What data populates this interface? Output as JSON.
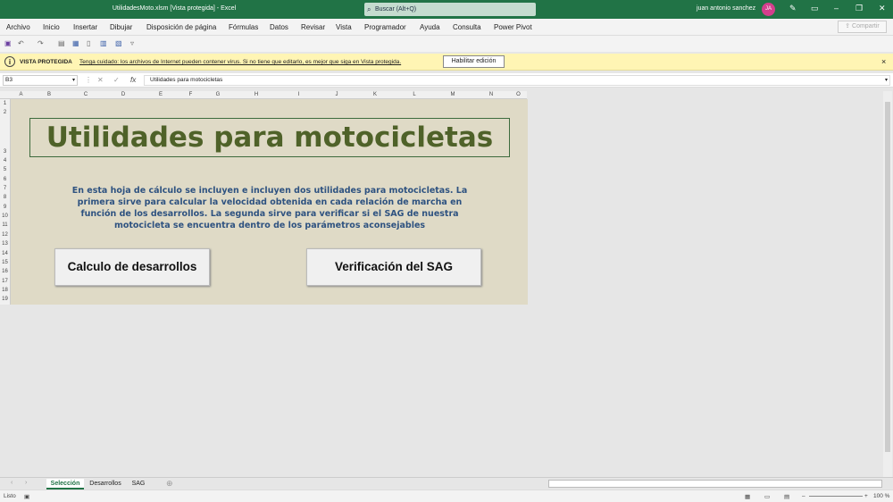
{
  "window": {
    "title": "UtilidadesMoto.xlsm  [Vista protegida]  -  Excel",
    "search_placeholder": "Buscar (Alt+Q)",
    "user_name": "juan antonio sanchez",
    "user_initials": "JA"
  },
  "ribbon": {
    "tabs": [
      "Archivo",
      "Inicio",
      "Insertar",
      "Dibujar",
      "Disposición de página",
      "Fórmulas",
      "Datos",
      "Revisar",
      "Vista",
      "Programador",
      "Ayuda",
      "Consulta",
      "Power Pivot"
    ],
    "share_label": "Compartir"
  },
  "protected_view": {
    "title": "VISTA PROTEGIDA",
    "message": "Tenga cuidado: los archivos de Internet pueden contener virus. Si no tiene que editarlo, es mejor que siga en Vista protegida.",
    "enable_label": "Habilitar edición"
  },
  "formula_bar": {
    "cell_ref": "B3",
    "content": "Utilidades para motocicletas"
  },
  "columns": [
    "A",
    "B",
    "C",
    "D",
    "E",
    "F",
    "G",
    "H",
    "I",
    "J",
    "K",
    "L",
    "M",
    "N",
    "O"
  ],
  "rows": [
    "1",
    "2",
    "3",
    "4",
    "5",
    "6",
    "7",
    "8",
    "9",
    "10",
    "11",
    "12",
    "13",
    "14",
    "15",
    "16",
    "17",
    "18",
    "19"
  ],
  "sheet_content": {
    "title": "Utilidades para motocicletas",
    "description": "En esta hoja de cálculo se incluyen e incluyen dos utilidades para motocicletas. La primera sirve para  calcular la velocidad obtenida en cada relación de marcha en función de los desarrollos. La segunda sirve para verificar si el SAG de nuestra motocicleta se encuentra dentro de los parámetros aconsejables",
    "button1": "Calculo de desarrollos",
    "button2": "Verificación del SAG",
    "title_color": "#4f6229",
    "description_color": "#2e5280",
    "background_color": "#dfdac6"
  },
  "sheet_tabs": [
    "Selección",
    "Desarrollos",
    "SAG"
  ],
  "status": {
    "ready": "Listo",
    "zoom": "100 %"
  }
}
